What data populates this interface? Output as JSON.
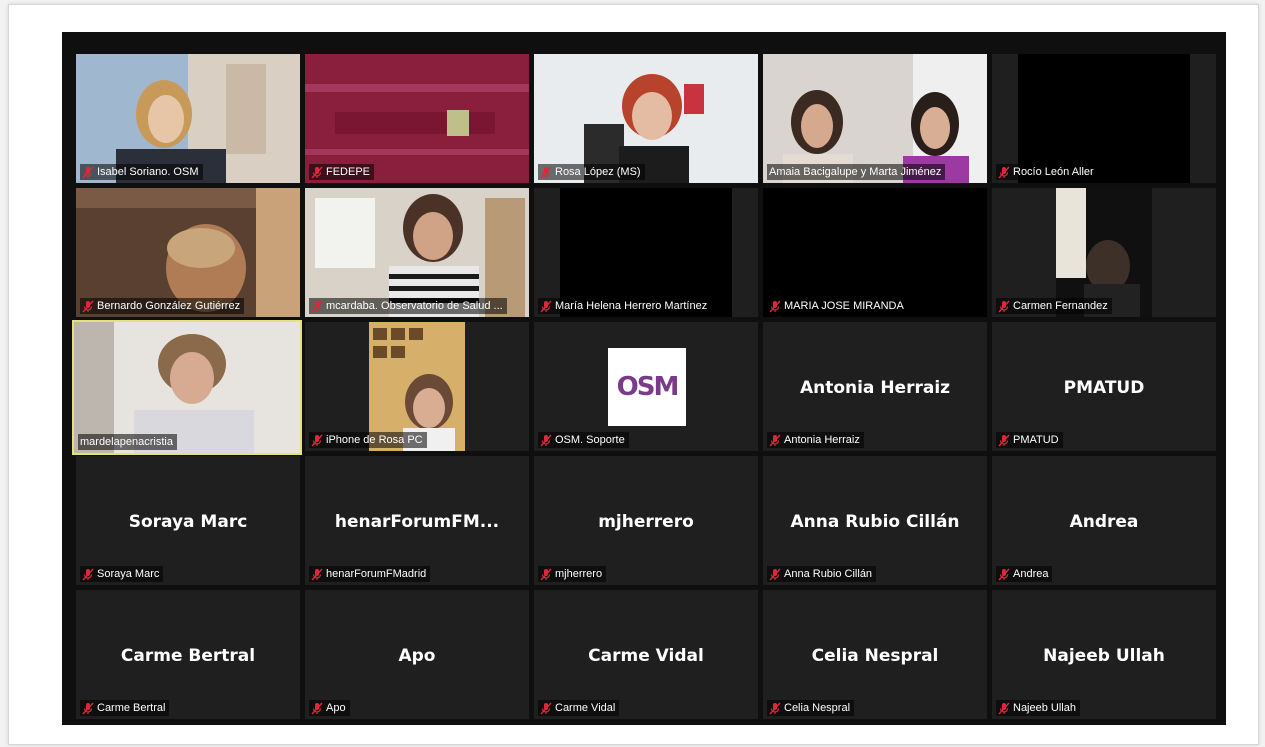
{
  "participants": [
    {
      "name": "Isabel Soriano. OSM",
      "muted": true,
      "video": true
    },
    {
      "name": "FEDEPE",
      "muted": true,
      "video": true
    },
    {
      "name": "Rosa López (MS)",
      "muted": true,
      "video": true
    },
    {
      "name": "Amaia Bacigalupe y Marta Jiménez",
      "muted": false,
      "video": true
    },
    {
      "name": "Rocío León Aller",
      "muted": true,
      "video": true
    },
    {
      "name": "Bernardo González Gutiérrez",
      "muted": true,
      "video": true
    },
    {
      "name": "mcardaba. Observatorio de Salud ...",
      "muted": true,
      "video": true
    },
    {
      "name": "María Helena Herrero Martínez",
      "muted": true,
      "video": true
    },
    {
      "name": "MARIA JOSE MIRANDA",
      "muted": true,
      "video": true
    },
    {
      "name": "Carmen Fernandez",
      "muted": true,
      "video": true
    },
    {
      "name": "mardelapenacristia",
      "muted": false,
      "video": true,
      "active_speaker": true
    },
    {
      "name": "iPhone de Rosa PC",
      "muted": true,
      "video": true
    },
    {
      "name": "OSM. Soporte",
      "muted": true,
      "video": false,
      "logo": "OSM"
    },
    {
      "name": "Antonia Herraiz",
      "muted": true,
      "video": false,
      "display_name": "Antonia Herraiz"
    },
    {
      "name": "PMATUD",
      "muted": true,
      "video": false,
      "display_name": "PMATUD"
    },
    {
      "name": "Soraya Marc",
      "muted": true,
      "video": false,
      "display_name": "Soraya Marc"
    },
    {
      "name": "henarForumFMadrid",
      "muted": true,
      "video": false,
      "display_name": "henarForumFM..."
    },
    {
      "name": "mjherrero",
      "muted": true,
      "video": false,
      "display_name": "mjherrero"
    },
    {
      "name": "Anna Rubio Cillán",
      "muted": true,
      "video": false,
      "display_name": "Anna Rubio Cillán"
    },
    {
      "name": "Andrea",
      "muted": true,
      "video": false,
      "display_name": "Andrea"
    },
    {
      "name": "Carme Bertral",
      "muted": true,
      "video": false,
      "display_name": "Carme Bertral"
    },
    {
      "name": "Apo",
      "muted": true,
      "video": false,
      "display_name": "Apo"
    },
    {
      "name": "Carme Vidal",
      "muted": true,
      "video": false,
      "display_name": "Carme Vidal"
    },
    {
      "name": "Celia Nespral",
      "muted": true,
      "video": false,
      "display_name": "Celia Nespral"
    },
    {
      "name": "Najeeb Ullah",
      "muted": true,
      "video": false,
      "display_name": "Najeeb Ullah"
    }
  ],
  "colors": {
    "background": "#0f0f0f",
    "tile": "#1f1f1f",
    "active_border": "#e4e27b",
    "muted_icon": "#e0263a",
    "logo_purple": "#7a3a8a"
  },
  "icons": {
    "muted": "microphone-muted-icon"
  }
}
